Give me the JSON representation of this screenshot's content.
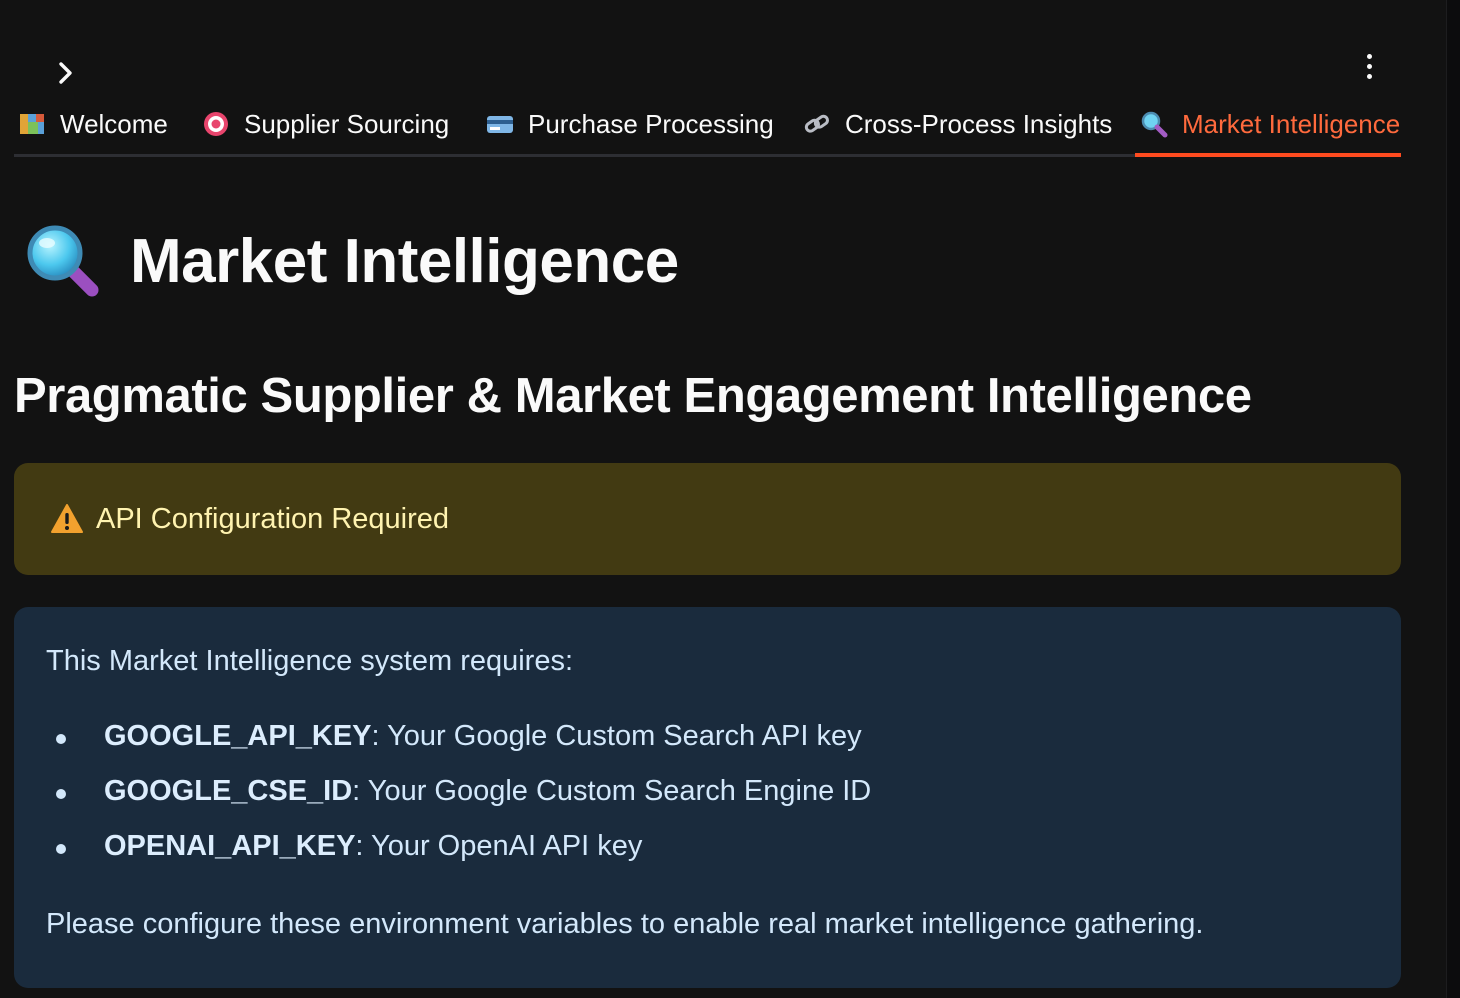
{
  "header": {
    "sidebar_toggle_icon": "chevron-right-icon",
    "menu_icon": "more-vertical-icon"
  },
  "tabs": [
    {
      "label": "Welcome",
      "icon": "map-icon"
    },
    {
      "label": "Supplier Sourcing",
      "icon": "target-icon"
    },
    {
      "label": "Purchase Processing",
      "icon": "credit-card-icon"
    },
    {
      "label": "Cross-Process Insights",
      "icon": "link-icon"
    },
    {
      "label": "Market Intelligence",
      "icon": "magnifier-icon",
      "active": true
    }
  ],
  "page": {
    "title": "Market Intelligence",
    "title_icon": "magnifier-icon",
    "subtitle": "Pragmatic Supplier & Market Engagement Intelligence"
  },
  "warning": {
    "icon": "warning-icon",
    "text": "API Configuration Required"
  },
  "info": {
    "intro": "This Market Intelligence system requires:",
    "items": [
      {
        "key": "GOOGLE_API_KEY",
        "desc": ": Your Google Custom Search API key"
      },
      {
        "key": "GOOGLE_CSE_ID",
        "desc": ": Your Google Custom Search Engine ID"
      },
      {
        "key": "OPENAI_API_KEY",
        "desc": ": Your OpenAI API key"
      }
    ],
    "outro": "Please configure these environment variables to enable real market intelligence gathering."
  },
  "colors": {
    "background": "#121212",
    "accent": "#ff4b1f",
    "warning_bg": "#423a12",
    "warning_text": "#fff3b0",
    "info_bg": "#1a2b3d",
    "info_text": "#d3e8fb"
  }
}
